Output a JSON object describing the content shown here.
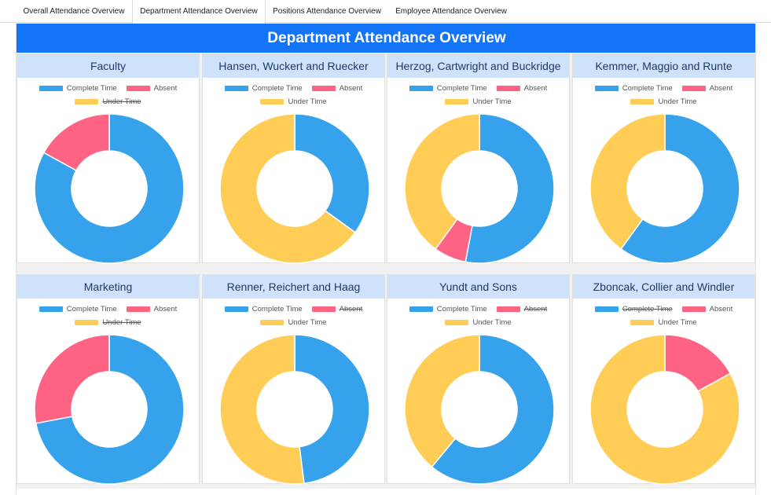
{
  "tabs": [
    {
      "label": "Overall Attendance Overview",
      "active": false
    },
    {
      "label": "Department Attendance Overview",
      "active": true
    },
    {
      "label": "Positions Attendance Overview",
      "active": false
    },
    {
      "label": "Employee Attendance Overview",
      "active": false
    }
  ],
  "page_title": "Department Attendance Overview",
  "colors": {
    "complete": "#36a2eb",
    "absent": "#ff6384",
    "under": "#ffcd56",
    "banner": "#1374f8",
    "card_header": "#cfe2fc"
  },
  "legend_labels": [
    "Complete Time",
    "Absent",
    "Under Time"
  ],
  "chart_data": [
    {
      "type": "pie",
      "title": "Faculty",
      "categories": [
        "Complete Time",
        "Absent",
        "Under Time"
      ],
      "values": [
        83,
        17,
        0
      ],
      "hidden": [
        false,
        false,
        true
      ]
    },
    {
      "type": "pie",
      "title": "Hansen, Wuckert and Ruecker",
      "categories": [
        "Complete Time",
        "Absent",
        "Under Time"
      ],
      "values": [
        35,
        0,
        65
      ],
      "hidden": [
        false,
        false,
        false
      ]
    },
    {
      "type": "pie",
      "title": "Herzog, Cartwright and Buckridge",
      "categories": [
        "Complete Time",
        "Absent",
        "Under Time"
      ],
      "values": [
        53,
        7,
        40
      ],
      "hidden": [
        false,
        false,
        false
      ]
    },
    {
      "type": "pie",
      "title": "Kemmer, Maggio and Runte",
      "categories": [
        "Complete Time",
        "Absent",
        "Under Time"
      ],
      "values": [
        60,
        0,
        40
      ],
      "hidden": [
        false,
        false,
        false
      ]
    },
    {
      "type": "pie",
      "title": "Marketing",
      "categories": [
        "Complete Time",
        "Absent",
        "Under Time"
      ],
      "values": [
        72,
        28,
        0
      ],
      "hidden": [
        false,
        false,
        true
      ]
    },
    {
      "type": "pie",
      "title": "Renner, Reichert and Haag",
      "categories": [
        "Complete Time",
        "Absent",
        "Under Time"
      ],
      "values": [
        48,
        0,
        52
      ],
      "hidden": [
        false,
        true,
        false
      ]
    },
    {
      "type": "pie",
      "title": "Yundt and Sons",
      "categories": [
        "Complete Time",
        "Absent",
        "Under Time"
      ],
      "values": [
        61,
        0,
        39
      ],
      "hidden": [
        false,
        true,
        false
      ]
    },
    {
      "type": "pie",
      "title": "Zboncak, Collier and Windler",
      "categories": [
        "Complete Time",
        "Absent",
        "Under Time"
      ],
      "values": [
        0,
        17,
        83
      ],
      "hidden": [
        true,
        false,
        false
      ]
    }
  ]
}
